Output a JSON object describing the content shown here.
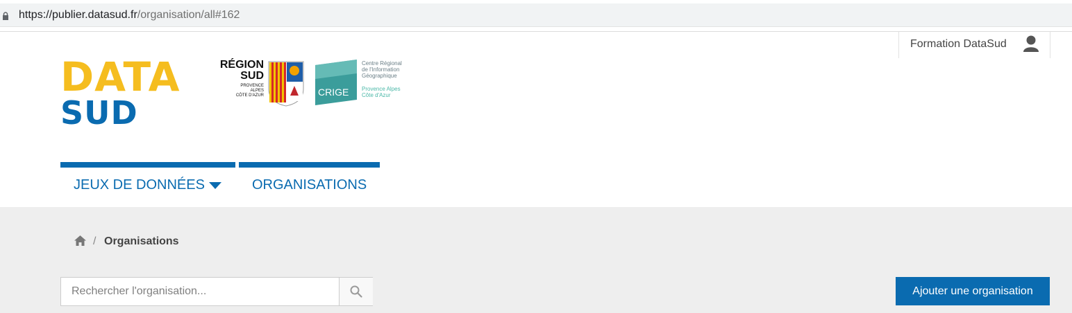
{
  "browser": {
    "url_host": "https://publier.datasud.fr",
    "url_path": "/organisation/all#162"
  },
  "account": {
    "label": "Formation DataSud"
  },
  "logo": {
    "line1": "DATA",
    "line2": "SUD"
  },
  "partners": {
    "region_line1": "RÉGION",
    "region_line2": "SUD",
    "region_sub": [
      "PROVENCE",
      "ALPES",
      "CÔTE D'AZUR"
    ],
    "crige_label": "CRIGE",
    "crige_desc": [
      "Centre Régional",
      "de l'Information",
      "Géographique"
    ],
    "crige_region": [
      "Provence Alpes",
      "Côte d'Azur"
    ]
  },
  "nav": {
    "items": [
      {
        "label": "JEUX DE DONNÉES"
      },
      {
        "label": "ORGANISATIONS"
      }
    ]
  },
  "breadcrumb": {
    "separator": "/",
    "current": "Organisations"
  },
  "search": {
    "placeholder": "Rechercher l'organisation..."
  },
  "actions": {
    "add_label": "Ajouter une organisation"
  },
  "colors": {
    "brand_blue": "#0a6bb0",
    "brand_yellow": "#f5bd1f",
    "gray_band": "#eeeeee"
  },
  "icons": [
    "lock-icon",
    "user-icon",
    "caret-down-icon",
    "home-icon",
    "search-icon"
  ]
}
